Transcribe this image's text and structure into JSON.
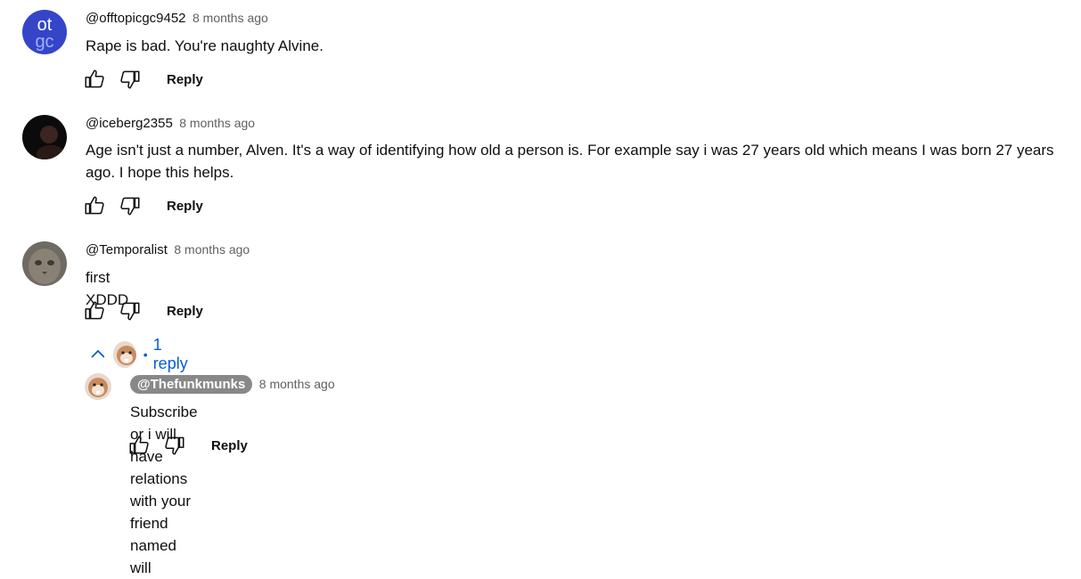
{
  "comments": [
    {
      "author": "@offtopicgc9452",
      "time": "8 months ago",
      "text": "Rape is bad. You're naughty Alvine.",
      "avatar_text_top": "ot",
      "avatar_text_bottom": "gc",
      "reply_label": "Reply"
    },
    {
      "author": "@iceberg2355",
      "time": "8 months ago",
      "text": "Age isn't just a number, Alven. It's a way of identifying how old a person is. For example say i was 27 years old which means I was born 27 years ago. I hope this helps.",
      "reply_label": "Reply"
    },
    {
      "author": "@Temporalist",
      "time": "8 months ago",
      "text": "first XDDD",
      "reply_label": "Reply",
      "replies_count_label": "1 reply",
      "replies_separator": "•"
    }
  ],
  "reply": {
    "author": "@Thefunkmunks",
    "time": "8 months ago",
    "text": "Subscribe or i will have relations with your friend named will",
    "reply_label": "Reply"
  },
  "colors": {
    "link_blue": "#065fd4",
    "secondary_text": "#606060",
    "owner_chip": "#888888"
  }
}
